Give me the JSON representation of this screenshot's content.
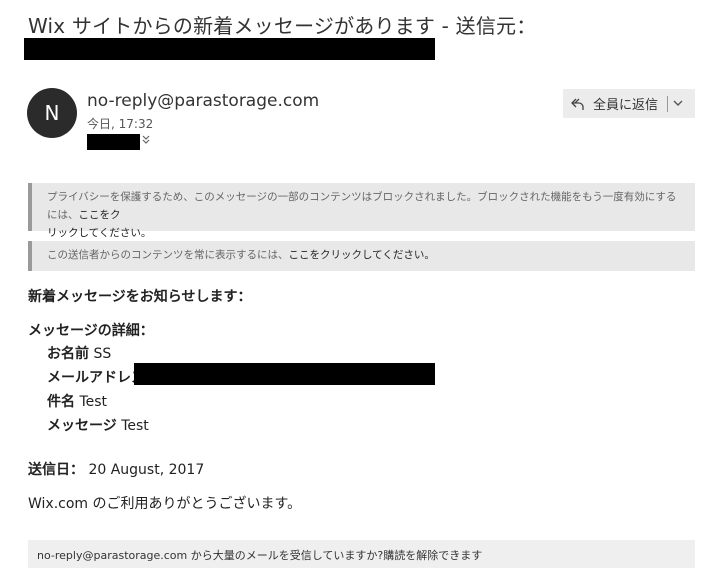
{
  "email": {
    "subject": "Wix サイトからの新着メッセージがあります - 送信元：",
    "sender_initial": "N",
    "sender": "no-reply@parastorage.com",
    "date": "今日, 17:32",
    "reply_all_label": "全員に返信"
  },
  "notices": {
    "privacy_text": "プライバシーを保護するため、このメッセージの一部のコンテンツはブロックされました。ブロックされた機能をもう一度有効にするには、",
    "privacy_link_a": "ここをク",
    "privacy_link_b": "リックしてください。",
    "sender_text": "この送信者からのコンテンツを常に表示するには、",
    "sender_link": "ここをクリックしてください。"
  },
  "content": {
    "intro": "新着メッセージをお知らせします：",
    "details_heading": "メッセージの詳細：",
    "fields": [
      {
        "key": "お名前",
        "value": "SS"
      },
      {
        "key": "メールアドレス",
        "value": ""
      },
      {
        "key": "件名",
        "value": "Test"
      },
      {
        "key": "メッセージ",
        "value": "Test"
      }
    ],
    "sent_label": "送信日：",
    "sent_date": "20 August, 2017",
    "thanks": "Wix.com のご利用ありがとうございます。"
  },
  "footer": {
    "text": "no-reply@parastorage.com から大量のメールを受信していますか?",
    "unsubscribe": "購読を解除できます"
  },
  "colors": {
    "avatar_bg": "#2b2b2b",
    "notice_bg": "#e8e8e8",
    "redaction": "#000000"
  }
}
